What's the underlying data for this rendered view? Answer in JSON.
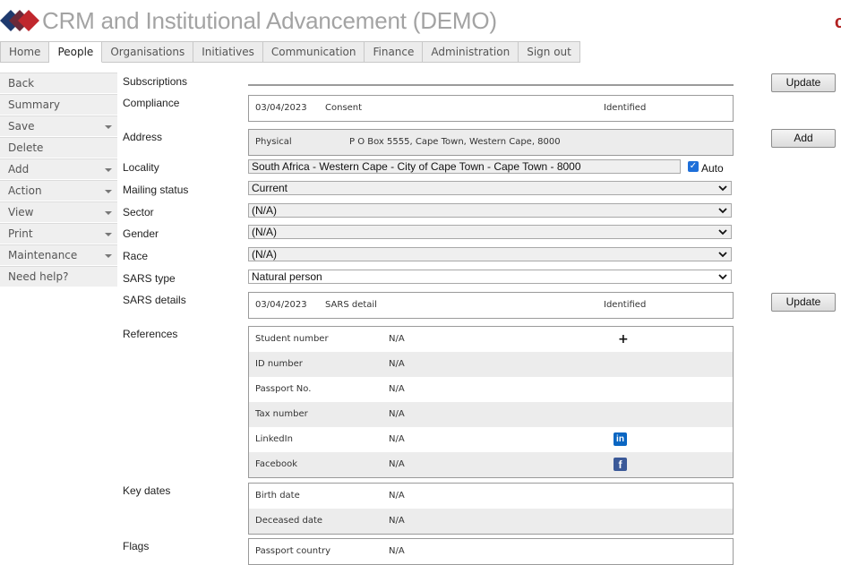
{
  "app": {
    "title": "CRM and Institutional Advancement (DEMO)",
    "corner_mark": "c"
  },
  "nav": {
    "tabs": [
      "Home",
      "People",
      "Organisations",
      "Initiatives",
      "Communication",
      "Finance",
      "Administration",
      "Sign out"
    ],
    "active": "People"
  },
  "sidebar": {
    "items": [
      {
        "label": "Back",
        "dropdown": false
      },
      {
        "label": "Summary",
        "dropdown": false
      },
      {
        "label": "Save",
        "dropdown": true
      },
      {
        "label": "Delete",
        "dropdown": false
      },
      {
        "label": "Add",
        "dropdown": true
      },
      {
        "label": "Action",
        "dropdown": true
      },
      {
        "label": "View",
        "dropdown": true
      },
      {
        "label": "Print",
        "dropdown": true
      },
      {
        "label": "Maintenance",
        "dropdown": true
      },
      {
        "label": "Need help?",
        "dropdown": false
      }
    ]
  },
  "form": {
    "subscriptions": {
      "label": "Subscriptions",
      "button": "Update"
    },
    "compliance": {
      "label": "Compliance",
      "date": "03/04/2023",
      "type": "Consent",
      "status": "Identified"
    },
    "address": {
      "label": "Address",
      "type": "Physical",
      "value": "P O Box 5555, Cape Town, Western Cape, 8000",
      "button": "Add"
    },
    "locality": {
      "label": "Locality",
      "value": "South Africa - Western Cape - City of Cape Town - Cape Town - 8000",
      "auto_label": "Auto",
      "auto_checked": true
    },
    "mailing_status": {
      "label": "Mailing status",
      "value": "Current"
    },
    "sector": {
      "label": "Sector",
      "value": "(N/A)"
    },
    "gender": {
      "label": "Gender",
      "value": "(N/A)"
    },
    "race": {
      "label": "Race",
      "value": "(N/A)"
    },
    "sars_type": {
      "label": "SARS type",
      "value": "Natural person"
    },
    "sars_details": {
      "label": "SARS details",
      "date": "03/04/2023",
      "type": "SARS detail",
      "status": "Identified",
      "button": "Update"
    },
    "references": {
      "label": "References",
      "rows": [
        {
          "name": "Student number",
          "value": "N/A",
          "icon": "plus-icon"
        },
        {
          "name": "ID number",
          "value": "N/A",
          "icon": ""
        },
        {
          "name": "Passport No.",
          "value": "N/A",
          "icon": ""
        },
        {
          "name": "Tax number",
          "value": "N/A",
          "icon": ""
        },
        {
          "name": "LinkedIn",
          "value": "N/A",
          "icon": "linkedin-icon"
        },
        {
          "name": "Facebook",
          "value": "N/A",
          "icon": "facebook-icon"
        }
      ]
    },
    "key_dates": {
      "label": "Key dates",
      "rows": [
        {
          "name": "Birth date",
          "value": "N/A"
        },
        {
          "name": "Deceased date",
          "value": "N/A"
        }
      ]
    },
    "flags": {
      "label": "Flags",
      "rows": [
        {
          "name": "Passport country",
          "value": "N/A"
        }
      ]
    }
  },
  "colors": {
    "linkedin": "#0a66c2",
    "facebook": "#3b5998",
    "logo_red": "#c0272d",
    "logo_blue": "#1f3a6e"
  }
}
